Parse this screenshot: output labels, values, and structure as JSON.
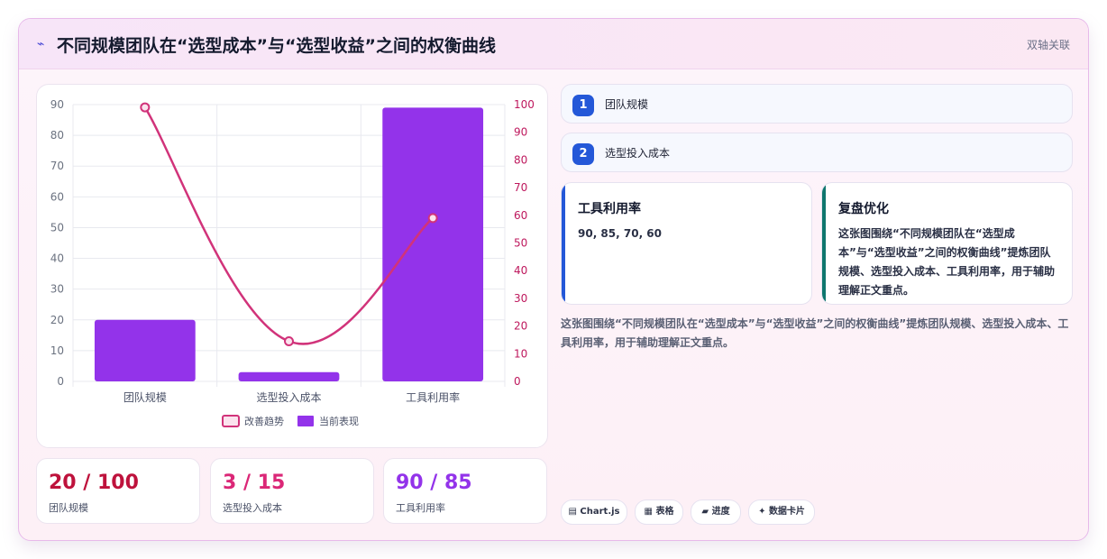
{
  "header": {
    "icon": "line-chart-icon",
    "title": "不同规模团队在“选型成本”与“选型收益”之间的权衡曲线",
    "badge": "双轴关联"
  },
  "chart_data": {
    "type": "bar",
    "categories": [
      "团队规模",
      "选型投入成本",
      "工具利用率"
    ],
    "series": [
      {
        "name": "当前表现",
        "type": "bar",
        "axis": "left",
        "color": "#9333ea",
        "values": [
          20,
          3,
          89
        ]
      },
      {
        "name": "改善趋势",
        "type": "line",
        "axis": "right",
        "color": "#d1337a",
        "values": [
          99,
          14.5,
          59
        ]
      }
    ],
    "left_axis": {
      "ylim": [
        0,
        90
      ],
      "ticks": [
        "0",
        "10",
        "20",
        "30",
        "40",
        "50",
        "60",
        "70",
        "80",
        "90"
      ]
    },
    "right_axis": {
      "ylim": [
        0,
        100
      ],
      "ticks": [
        "0",
        "10",
        "20",
        "30",
        "40",
        "50",
        "60",
        "70",
        "80",
        "90",
        "100"
      ]
    },
    "grid": true,
    "legend": "bottom"
  },
  "metrics": [
    {
      "value": "20 / 100",
      "label": "团队规模",
      "color": "#be123c"
    },
    {
      "value": "3 / 15",
      "label": "选型投入成本",
      "color": "#db2777"
    },
    {
      "value": "90 / 85",
      "label": "工具利用率",
      "color": "#9333ea"
    }
  ],
  "steps": [
    {
      "num": "1",
      "label": "团队规模"
    },
    {
      "num": "2",
      "label": "选型投入成本"
    }
  ],
  "info_cards": [
    {
      "title": "工具利用率",
      "body": "90, 85, 70, 60",
      "accent": "#2458d8"
    },
    {
      "title": "复盘优化",
      "body": "这张图围绕“不同规模团队在“选型成本”与“选型收益”之间的权衡曲线”提炼团队规模、选型投入成本、工具利用率，用于辅助理解正文重点。",
      "accent": "#0f766e"
    }
  ],
  "summary": "这张图围绕“不同规模团队在“选型成本”与“选型收益”之间的权衡曲线”提炼团队规模、选型投入成本、工具利用率，用于辅助理解正文重点。",
  "tags": [
    {
      "icon": "chart-icon",
      "glyph": "▤",
      "label": "Chart.js"
    },
    {
      "icon": "table-icon",
      "glyph": "▦",
      "label": "表格"
    },
    {
      "icon": "progress-icon",
      "glyph": "▰",
      "label": "进度"
    },
    {
      "icon": "sparkle-icon",
      "glyph": "✦",
      "label": "数据卡片"
    }
  ]
}
